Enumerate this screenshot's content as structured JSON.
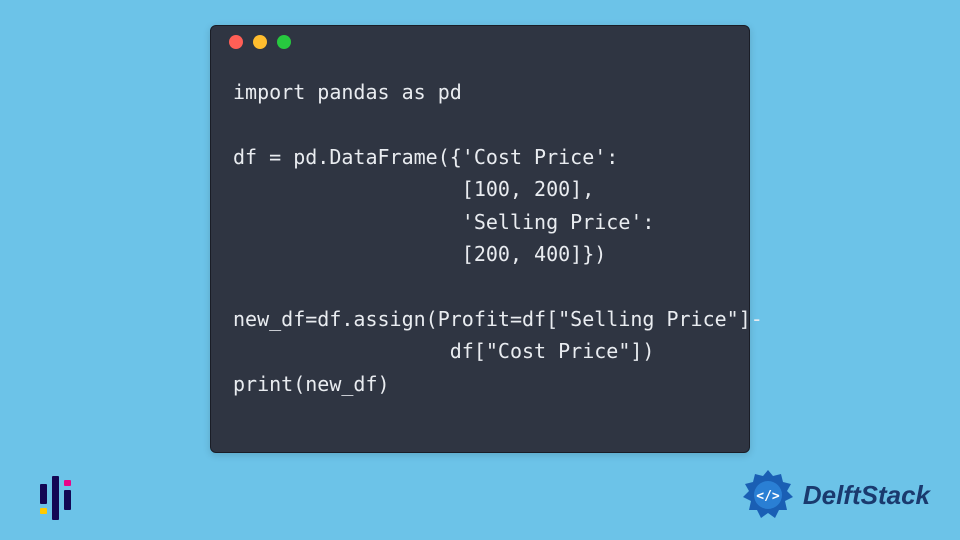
{
  "code": {
    "lines": [
      "import pandas as pd",
      "",
      "df = pd.DataFrame({'Cost Price':",
      "                   [100, 200],",
      "                   'Selling Price':",
      "                   [200, 400]})",
      "",
      "new_df=df.assign(Profit=df[\"Selling Price\"]-",
      "                  df[\"Cost Price\"])",
      "print(new_df)"
    ]
  },
  "brand": {
    "name": "DelftStack"
  },
  "window_dots": {
    "red": "#ff5f56",
    "yellow": "#ffbd2e",
    "green": "#27c93f"
  }
}
